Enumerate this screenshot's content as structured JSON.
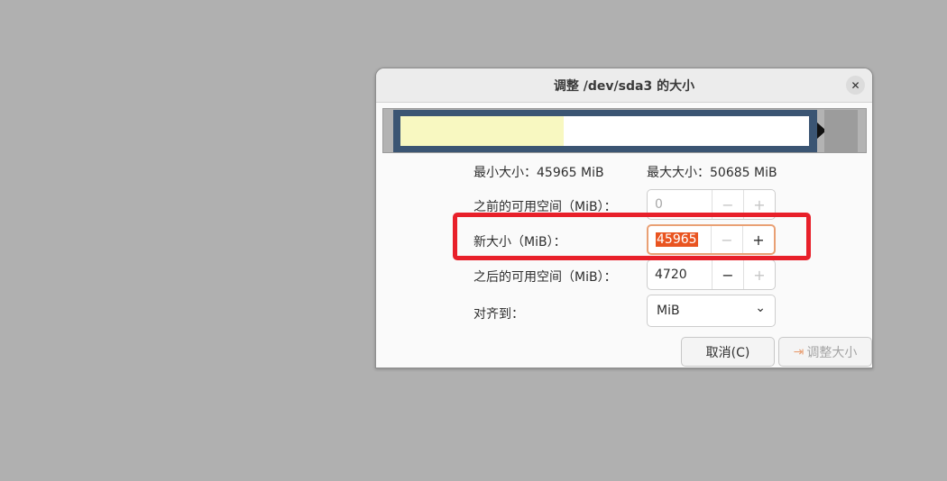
{
  "dialog": {
    "title": "调整 /dev/sda3 的大小",
    "close_icon": "✕"
  },
  "partition_bar": {
    "used_fraction": 0.4
  },
  "info": {
    "min_size": "最小大小：45965 MiB",
    "max_size": "最大大小：50685 MiB"
  },
  "fields": {
    "free_before": {
      "label": "之前的可用空间（MiB）：",
      "value": "0"
    },
    "new_size": {
      "label": "新大小（MiB）：",
      "value": "45965"
    },
    "free_after": {
      "label": "之后的可用空间（MiB）：",
      "value": "4720"
    },
    "align": {
      "label": "对齐到：",
      "value": "MiB"
    }
  },
  "icons": {
    "minus": "−",
    "plus": "+",
    "chevron": "⌄",
    "resize_arrow": "⇥"
  },
  "buttons": {
    "cancel": "取消(C)",
    "resize": "调整大小"
  },
  "colors": {
    "accent": "#e95420",
    "highlight": "#e8202a",
    "partition_border": "#3b5573",
    "used_space": "#f8f8c1"
  }
}
